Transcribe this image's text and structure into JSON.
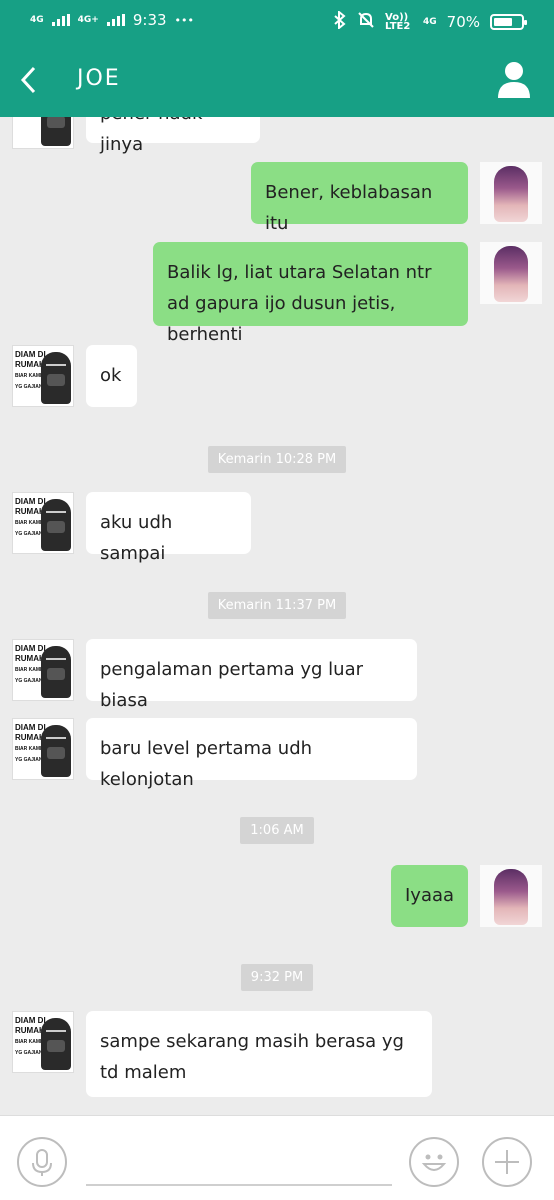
{
  "status_bar": {
    "network1": "4G",
    "network2": "4G+",
    "time": "9:33",
    "more": "•••",
    "volte": "Vo)) LTE2",
    "network3": "4G",
    "battery": "70%",
    "battery_level": 0.7
  },
  "header": {
    "title": "JOE",
    "back_icon": "chevron-left-icon",
    "profile_icon": "user-icon",
    "color": "#17a085"
  },
  "avatar_joe": {
    "line1": "DIAM DI",
    "line2": "RUMAH !!",
    "line3": "BIAR KAMI AJA",
    "line4": "YG GAJIAN"
  },
  "messages": [
    {
      "from": "joe",
      "text": "pener nadk jinya"
    },
    {
      "from": "me",
      "text": "Bener, keblabasan itu"
    },
    {
      "from": "me",
      "text": "Balik lg, liat utara Selatan ntr ad gapura ijo dusun jetis, berhenti"
    },
    {
      "from": "joe",
      "text": "ok"
    },
    {
      "type": "timestamp",
      "text": "Kemarin 10:28 PM"
    },
    {
      "from": "joe",
      "text": "aku udh sampai"
    },
    {
      "type": "timestamp",
      "text": "Kemarin 11:37 PM"
    },
    {
      "from": "joe",
      "text": "pengalaman pertama yg luar biasa"
    },
    {
      "from": "joe",
      "text": "baru level pertama udh kelonjotan"
    },
    {
      "type": "timestamp",
      "text": "1:06 AM"
    },
    {
      "from": "me",
      "text": "Iyaaa"
    },
    {
      "type": "timestamp",
      "text": "9:32 PM"
    },
    {
      "from": "joe",
      "text": "sampe sekarang masih berasa yg td malem"
    }
  ],
  "input_bar": {
    "placeholder": "",
    "mic_icon": "microphone-icon",
    "emoji_icon": "smiley-icon",
    "add_icon": "plus-icon"
  },
  "colors": {
    "incoming_bubble": "#ffffff",
    "outgoing_bubble": "#8bde85",
    "background": "#ececec",
    "timestamp_bg": "#d4d4d4"
  }
}
